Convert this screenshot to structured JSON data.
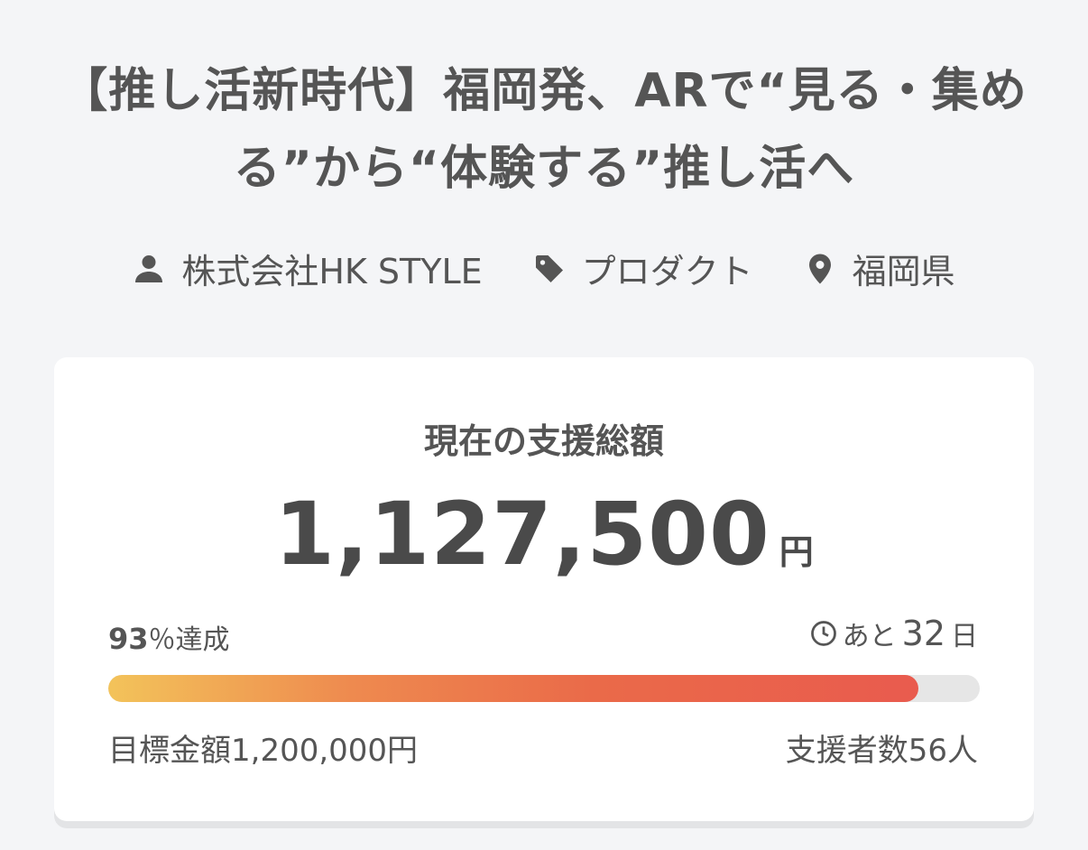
{
  "project": {
    "title": "【推し活新時代】福岡発、ARで“見る・集める”から“体験する”推し活へ",
    "owner": "株式会社HK STYLE",
    "category": "プロダクト",
    "location": "福岡県"
  },
  "icons": {
    "owner": "person-icon",
    "category": "tag-icon",
    "location": "map-pin-icon",
    "remaining": "clock-icon"
  },
  "funding": {
    "label": "現在の支援総額",
    "amount": "1,127,500",
    "currency": "円",
    "percent": "93",
    "percent_suffix": "％達成",
    "progress_fraction": 0.93,
    "remaining_prefix": "あと",
    "remaining_days": "32",
    "remaining_suffix": "日",
    "goal": "目標金額1,200,000円",
    "supporters": "支援者数56人"
  },
  "colors": {
    "background": "#f4f5f7",
    "text": "#555555",
    "bar_start": "#f3c35a",
    "bar_end": "#e95b4e",
    "bar_track": "#e6e6e6"
  }
}
